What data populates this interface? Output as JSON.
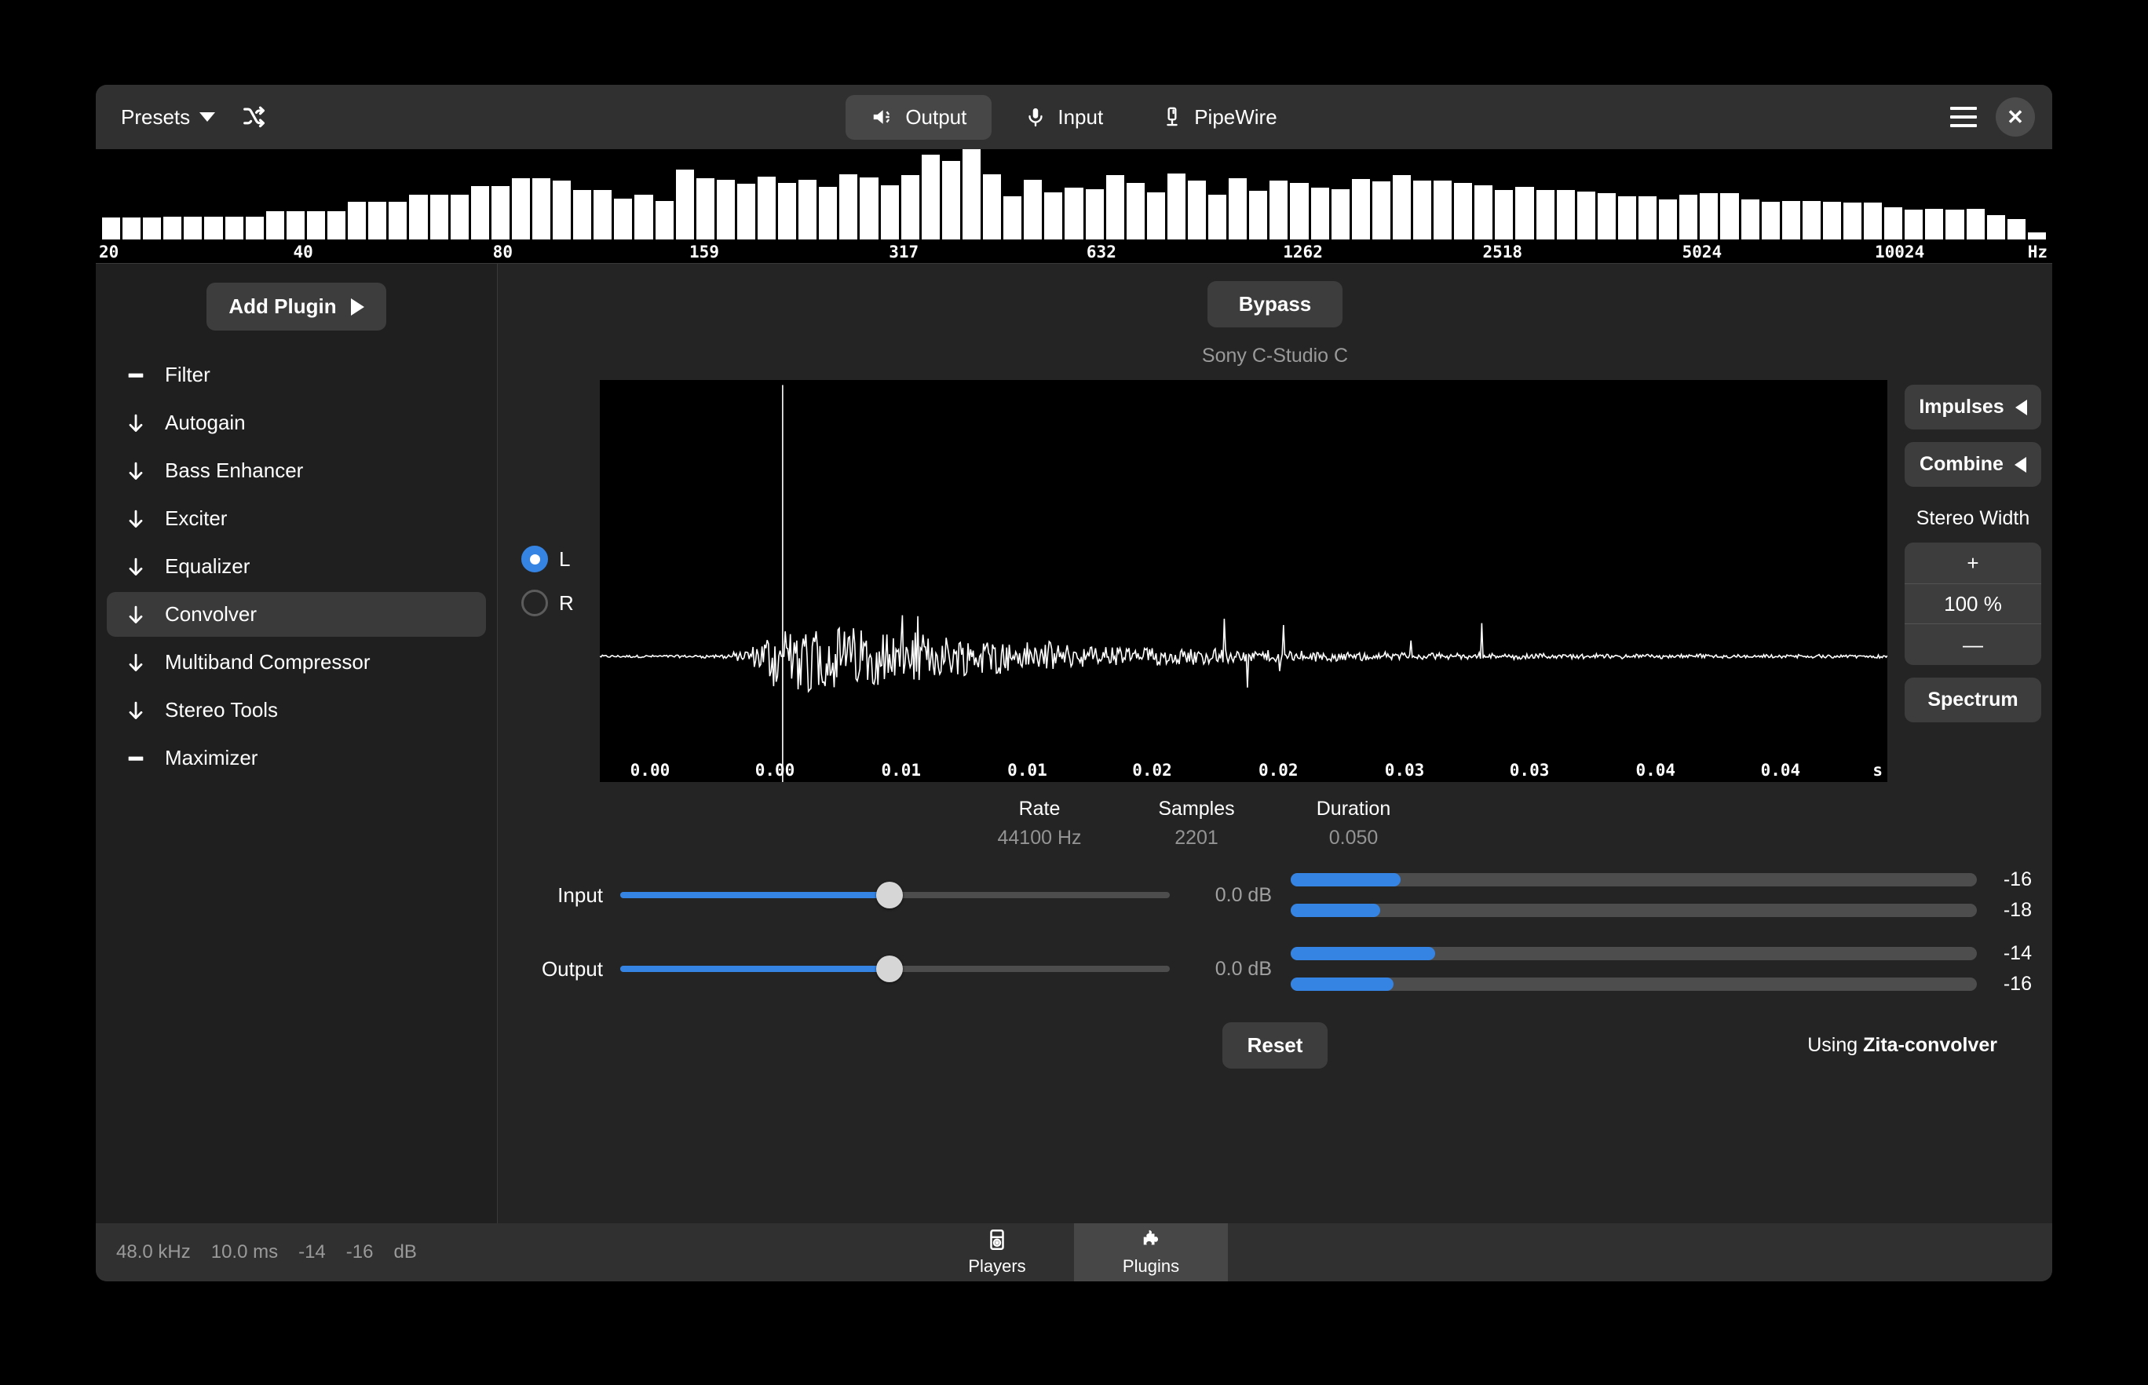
{
  "header": {
    "presets_label": "Presets",
    "shuffle_icon": "shuffle-icon",
    "tabs": [
      {
        "label": "Output",
        "icon": "speaker-icon",
        "active": true
      },
      {
        "label": "Input",
        "icon": "microphone-icon",
        "active": false
      },
      {
        "label": "PipeWire",
        "icon": "pipewire-icon",
        "active": false
      }
    ],
    "menu_icon": "hamburger-menu-icon",
    "close_icon": "close-icon"
  },
  "sidebar": {
    "add_plugin_label": "Add Plugin",
    "items": [
      {
        "label": "Filter",
        "icon": "bar-icon",
        "selected": false
      },
      {
        "label": "Autogain",
        "icon": "arrow-down-icon",
        "selected": false
      },
      {
        "label": "Bass Enhancer",
        "icon": "arrow-down-icon",
        "selected": false
      },
      {
        "label": "Exciter",
        "icon": "arrow-down-icon",
        "selected": false
      },
      {
        "label": "Equalizer",
        "icon": "arrow-down-icon",
        "selected": false
      },
      {
        "label": "Convolver",
        "icon": "arrow-down-icon",
        "selected": true
      },
      {
        "label": "Multiband Compressor",
        "icon": "arrow-down-icon",
        "selected": false
      },
      {
        "label": "Stereo Tools",
        "icon": "arrow-down-icon",
        "selected": false
      },
      {
        "label": "Maximizer",
        "icon": "bar-icon",
        "selected": false
      }
    ]
  },
  "main": {
    "bypass_label": "Bypass",
    "impulse_name": "Sony C-Studio C",
    "channels": [
      {
        "label": "L",
        "selected": true
      },
      {
        "label": "R",
        "selected": false
      }
    ],
    "side_buttons": {
      "impulses_label": "Impulses",
      "combine_label": "Combine",
      "stereo_width_label": "Stereo Width",
      "stereo_width_value": "100 %",
      "plus_label": "+",
      "minus_label": "—",
      "spectrum_label": "Spectrum"
    },
    "info": [
      {
        "key": "Rate",
        "value": "44100 Hz"
      },
      {
        "key": "Samples",
        "value": "2201"
      },
      {
        "key": "Duration",
        "value": "0.050"
      }
    ],
    "controls": [
      {
        "label": "Input",
        "value": "0.0 dB",
        "slider_pct": 49,
        "meters": [
          {
            "value": "-16",
            "pct": 16
          },
          {
            "value": "-18",
            "pct": 13
          }
        ]
      },
      {
        "label": "Output",
        "value": "0.0 dB",
        "slider_pct": 49,
        "meters": [
          {
            "value": "-14",
            "pct": 21
          },
          {
            "value": "-16",
            "pct": 15
          }
        ]
      }
    ],
    "reset_label": "Reset",
    "using_prefix": "Using",
    "using_engine": "Zita-convolver"
  },
  "statusbar": {
    "rate": "48.0 kHz",
    "latency": "10.0 ms",
    "level_left": "-14",
    "level_right": "-16",
    "unit": "dB",
    "tabs": [
      {
        "label": "Players",
        "icon": "media-player-icon",
        "active": false
      },
      {
        "label": "Plugins",
        "icon": "puzzle-piece-icon",
        "active": true
      }
    ]
  },
  "colors": {
    "accent": "#3584e4",
    "window_bg": "#242424",
    "header_bg": "#303030",
    "sidebar_bg": "#1f1f1f",
    "button_bg": "#3d3d3d",
    "graph_bg": "#000000"
  },
  "chart_data": [
    {
      "type": "bar",
      "name": "output-spectrum-analyzer",
      "title": "",
      "xlabel": "Hz",
      "ylabel": "",
      "grid": false,
      "legend": null,
      "tick_labels": [
        "20",
        "40",
        "80",
        "159",
        "317",
        "632",
        "1262",
        "2518",
        "5024",
        "10024",
        "Hz"
      ],
      "tick_positions_pct": [
        0.5,
        10.6,
        20.8,
        31.1,
        41.3,
        51.4,
        61.7,
        71.9,
        82.1,
        92.2,
        99.5
      ],
      "values": [
        24,
        24,
        24,
        25,
        25,
        25,
        25,
        25,
        31,
        31,
        31,
        31,
        42,
        42,
        42,
        50,
        50,
        50,
        59,
        59,
        68,
        68,
        65,
        55,
        55,
        45,
        50,
        43,
        77,
        68,
        66,
        62,
        70,
        63,
        66,
        58,
        72,
        69,
        60,
        71,
        94,
        87,
        100,
        72,
        48,
        66,
        52,
        57,
        56,
        71,
        63,
        52,
        73,
        65,
        50,
        68,
        54,
        65,
        63,
        57,
        56,
        67,
        64,
        71,
        65,
        65,
        63,
        60,
        55,
        58,
        55,
        55,
        53,
        51,
        48,
        48,
        44,
        50,
        51,
        51,
        44,
        42,
        43,
        43,
        42,
        41,
        41,
        36,
        33,
        34,
        33,
        34,
        27,
        23,
        8
      ],
      "ylim": [
        0,
        100
      ]
    },
    {
      "type": "line",
      "name": "impulse-response-waveform",
      "title": "Sony C-Studio C",
      "xlabel": "s",
      "ylabel": "",
      "grid": false,
      "tick_labels": [
        "0.00",
        "0.00",
        "0.01",
        "0.01",
        "0.02",
        "0.02",
        "0.03",
        "0.03",
        "0.04",
        "0.04",
        "s"
      ],
      "tick_positions_pct": [
        3.9,
        13.6,
        23.4,
        33.2,
        42.9,
        52.7,
        62.5,
        72.2,
        82.0,
        91.7,
        99.4
      ],
      "sample_rate_hz": 44100,
      "samples": 2201,
      "duration_s": 0.05,
      "peak_position_pct": 14.2,
      "peak_amplitude": 1.0
    }
  ]
}
